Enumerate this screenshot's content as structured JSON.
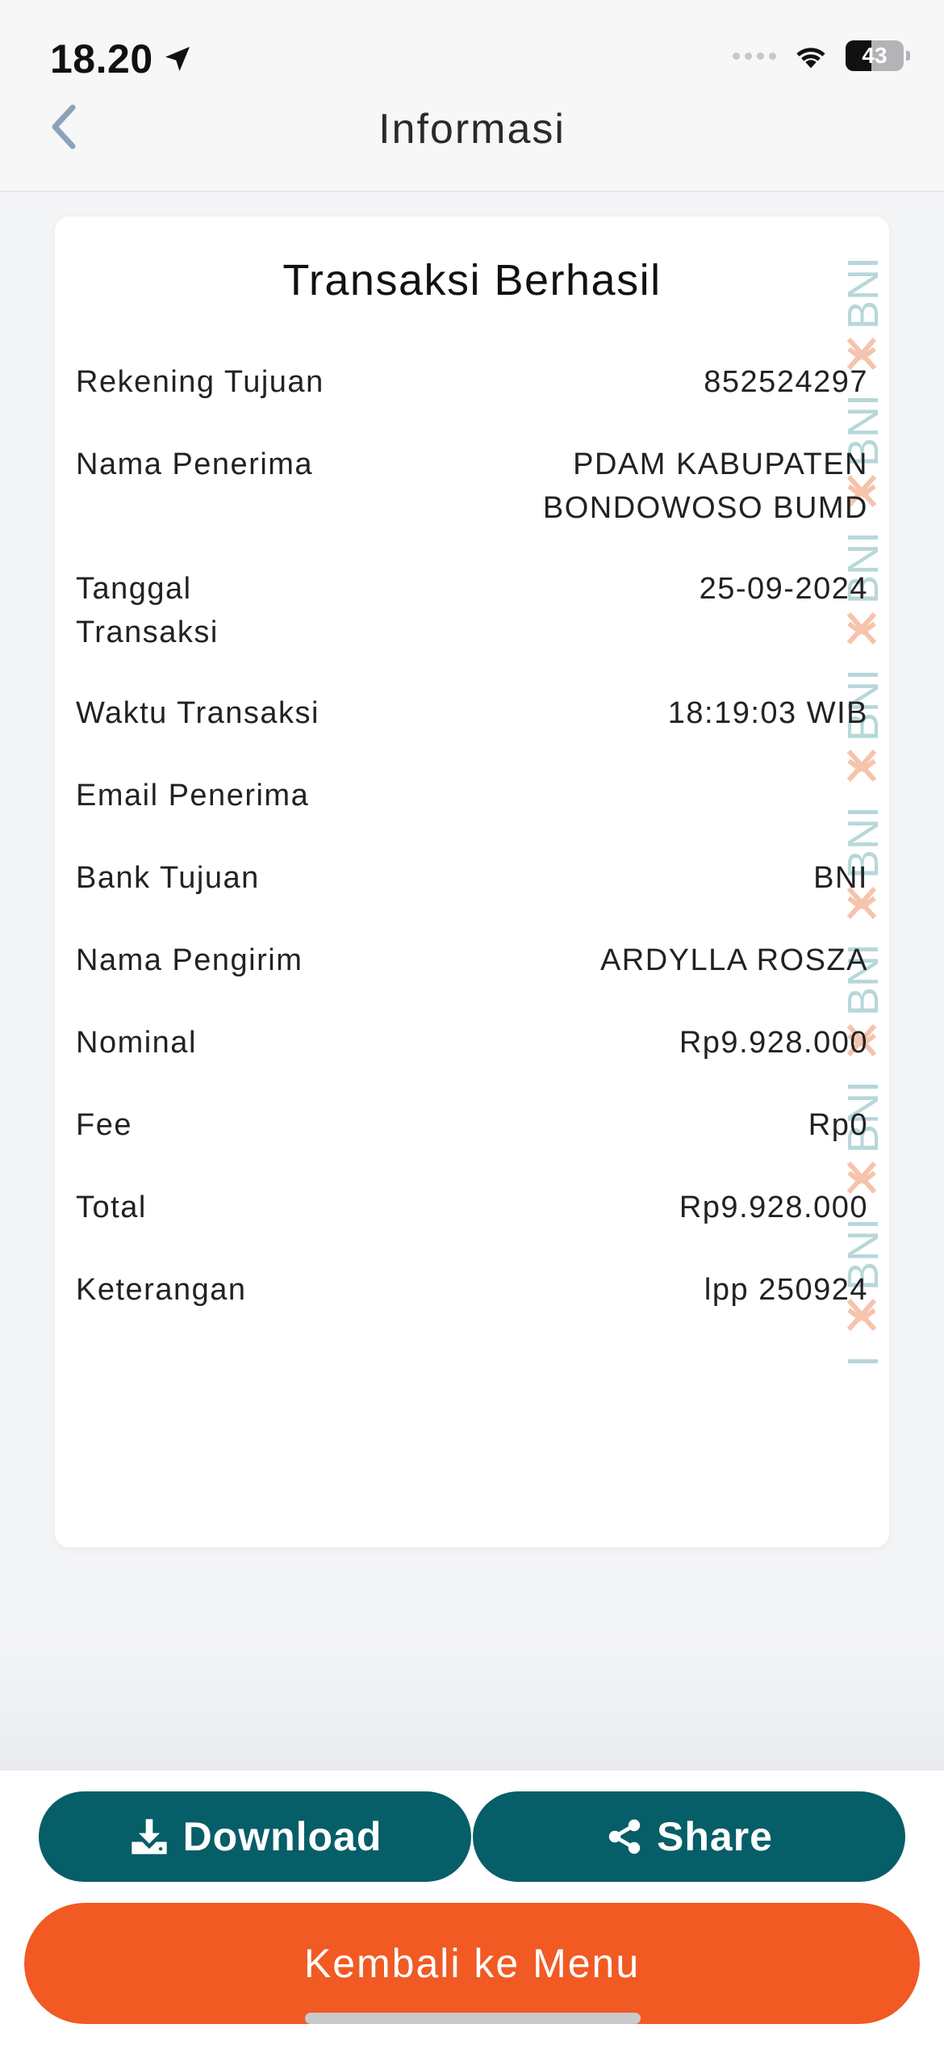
{
  "status_bar": {
    "time": "18.20",
    "battery": "43"
  },
  "header": {
    "title": "Informasi"
  },
  "receipt": {
    "title": "Transaksi Berhasil",
    "watermark_text": "BNI",
    "rows": [
      {
        "label": "Rekening Tujuan",
        "value": "852524297"
      },
      {
        "label": "Nama Penerima",
        "value": "PDAM KABUPATEN\nBONDOWOSO BUMD"
      },
      {
        "label": "Tanggal\nTransaksi",
        "value": "25-09-2024"
      },
      {
        "label": "Waktu Transaksi",
        "value": "18:19:03 WIB"
      },
      {
        "label": "Email Penerima",
        "value": ""
      },
      {
        "label": "Bank Tujuan",
        "value": "BNI"
      },
      {
        "label": "Nama Pengirim",
        "value": "ARDYLLA ROSZA"
      },
      {
        "label": "Nominal",
        "value": "Rp9.928.000"
      },
      {
        "label": "Fee",
        "value": "Rp0"
      },
      {
        "label": "Total",
        "value": "Rp9.928.000"
      },
      {
        "label": "Keterangan",
        "value": "lpp 250924"
      }
    ]
  },
  "actions": {
    "download_label": "Download",
    "share_label": "Share",
    "menu_label": "Kembali ke Menu"
  },
  "colors": {
    "primary_teal": "#055e68",
    "accent_orange": "#f15a23",
    "watermark_teal": "#b7d7d9",
    "watermark_orange": "#f6c3ac"
  },
  "icons": {
    "back": "chevron-left-icon",
    "download": "download-icon",
    "share": "share-icon",
    "location": "location-arrow-icon",
    "wifi": "wifi-icon",
    "signal": "cellular-signal-icon",
    "battery": "battery-icon"
  }
}
